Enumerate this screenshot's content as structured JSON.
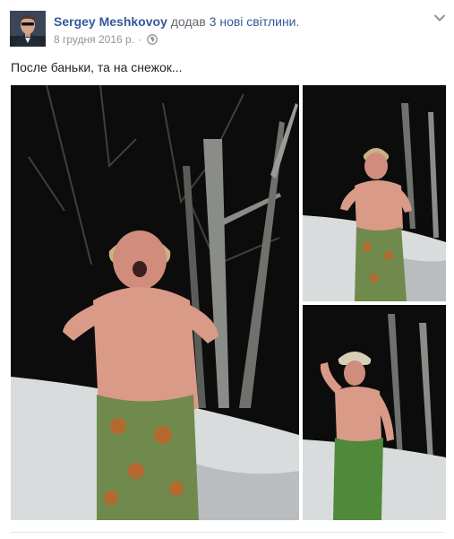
{
  "post": {
    "author": "Sergey Meshkovoy",
    "action_prefix": "додав ",
    "action_link": "3 нові світлини",
    "action_suffix": ".",
    "date": "8 грудня 2016 р.",
    "separator": "·",
    "privacy_icon": "globe-icon",
    "menu_icon": "chevron-down-icon",
    "text": "После баньки, та на снежок..."
  },
  "photos": [
    {
      "name": "photo-main"
    },
    {
      "name": "photo-top"
    },
    {
      "name": "photo-bottom"
    }
  ],
  "colors": {
    "link": "#365899",
    "meta": "#90949c",
    "text": "#1d2129",
    "divider": "#e5e5e5"
  }
}
